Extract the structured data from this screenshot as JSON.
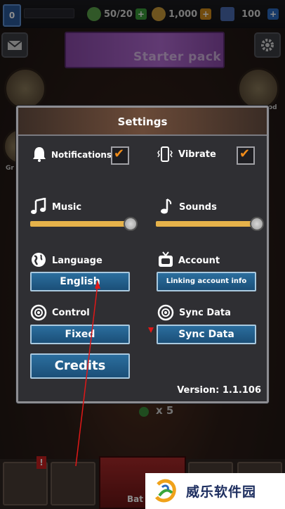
{
  "topbar": {
    "level": "0",
    "energy": "50/20",
    "gold": "1,000",
    "gems": "100"
  },
  "banner": {
    "starter_pack": "Starter pack"
  },
  "side": {
    "left_label": "Gr",
    "right_label": "od"
  },
  "settings": {
    "title": "Settings",
    "notifications_label": "Notifications",
    "notifications_checked": true,
    "vibrate_label": "Vibrate",
    "vibrate_checked": true,
    "music_label": "Music",
    "music_level": 1.0,
    "sounds_label": "Sounds",
    "sounds_level": 1.0,
    "language_label": "Language",
    "language_value": "English",
    "account_label": "Account",
    "account_button": "Linking account info",
    "control_label": "Control",
    "control_value": "Fixed",
    "sync_label": "Sync Data",
    "sync_button": "Sync Data",
    "credits_button": "Credits",
    "version": "Version: 1.1.106"
  },
  "background": {
    "reward_count": "x 5"
  },
  "bottom": {
    "battle_label": "Bat"
  },
  "watermark": {
    "text": "威乐软件园"
  },
  "colors": {
    "accent_orange": "#f08c1a",
    "button_blue": "#1b4f78",
    "slider_gold": "#e6b24a"
  }
}
